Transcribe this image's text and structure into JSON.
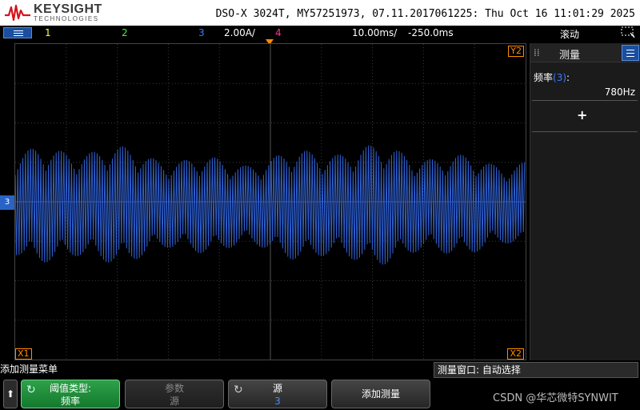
{
  "header": {
    "brand": "KEYSIGHT",
    "brand_sub": "TECHNOLOGIES",
    "instrument_info": "DSO-X 3024T, MY57251973, 07.11.2017061225: Thu Oct 16 11:01:29 2025",
    "brand_color": "#d4141c"
  },
  "status_bar": {
    "ch1": "1",
    "ch2": "2",
    "ch3": "3",
    "ch3_scale": "2.00A/",
    "ch4": "4",
    "timebase": "10.00ms/",
    "delay": "-250.0ms",
    "mode": "滚动",
    "colors": {
      "ch1": "#ffff33",
      "ch2": "#33ff33",
      "ch3": "#3a7bff",
      "ch4": "#ff3399"
    }
  },
  "display": {
    "ch3_marker": "3",
    "y2_label": "Y2",
    "x1_label": "X1",
    "x2_label": "X2",
    "waveform_color": "#2f5fd0",
    "trigger_marker_color": "#ff8c00"
  },
  "side_panel": {
    "title": "测量",
    "measurement_label": "频率",
    "measurement_source": "(3)",
    "measurement_colon": ":",
    "measurement_value": "780Hz",
    "add_symbol": "+"
  },
  "softkey_bar": {
    "title": "添加测量菜单",
    "meas_window_label": "测量窗口: 自动选择",
    "keys": [
      {
        "line1": "阈值类型:",
        "line2": "频率"
      },
      {
        "line1": "参数",
        "line2": "源"
      },
      {
        "line1": "源",
        "line2": "3"
      },
      {
        "line1": "添加测量"
      }
    ],
    "back_symbol": "⬆"
  },
  "watermark": "CSDN @华芯微特SYNWIT"
}
